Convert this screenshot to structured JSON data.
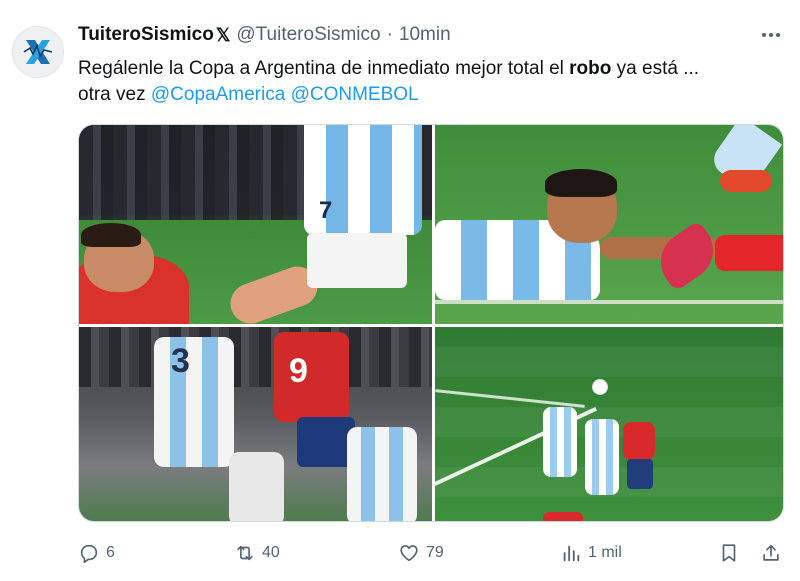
{
  "tweet": {
    "author": {
      "display_name": "TuiteroSismico",
      "badge": "𝕏",
      "handle": "@TuiteroSismico",
      "separator": "·",
      "time": "10min",
      "avatar_icon": "seismic-x-logo-icon"
    },
    "text": {
      "line1_before": "Regálenle la Copa a Argentina de inmediato mejor total el ",
      "line1_bold": "robo",
      "line1_after": " ya está  ...",
      "line2_prefix": "otra vez ",
      "mention1": "@CopaAmerica",
      "mention2": "@CONMEBOL"
    },
    "media": {
      "images": [
        {
          "name": "argentina-7-vs-chile-player-clash"
        },
        {
          "name": "argentina-player-stretched-on-grass"
        },
        {
          "name": "argentina-vs-chile-number-9-challenge"
        },
        {
          "name": "aerial-play-wide-shot"
        }
      ]
    },
    "actions": {
      "replies": "6",
      "retweets": "40",
      "likes": "79",
      "views": "1 mil"
    }
  },
  "colors": {
    "link": "#1d9bf0",
    "secondary_text": "#536471",
    "primary_text": "#0f1419"
  }
}
